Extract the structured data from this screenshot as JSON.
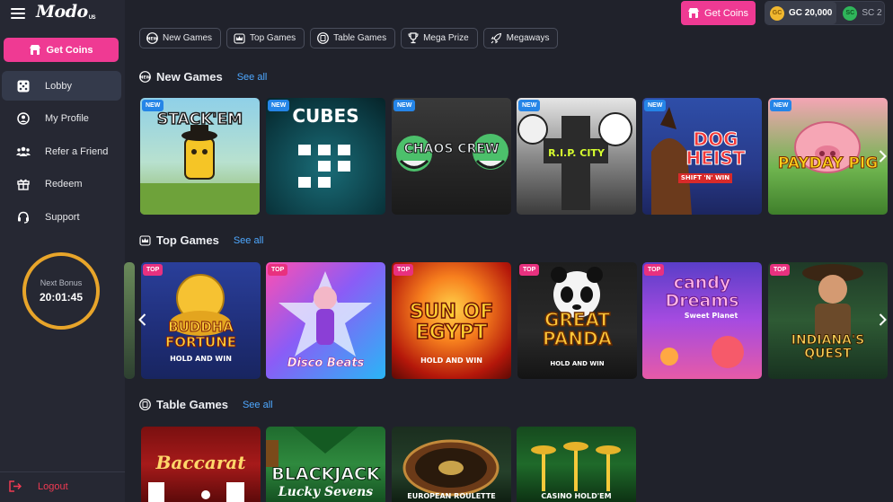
{
  "logo": {
    "name": "Modo",
    "suffix": "US"
  },
  "sidebar": {
    "get_coins": "Get Coins",
    "items": [
      {
        "label": "Lobby",
        "icon": "dice-icon"
      },
      {
        "label": "My Profile",
        "icon": "user-circle-icon"
      },
      {
        "label": "Refer a Friend",
        "icon": "users-icon"
      },
      {
        "label": "Redeem",
        "icon": "gift-icon"
      },
      {
        "label": "Support",
        "icon": "headset-icon"
      }
    ],
    "bonus": {
      "title": "Next Bonus",
      "time": "20:01:45"
    },
    "logout": "Logout"
  },
  "topbar": {
    "get_coins": "Get Coins",
    "gc": {
      "label": "GC 20,000",
      "icon": "GC"
    },
    "sc": {
      "label": "SC 2",
      "icon": "SC"
    }
  },
  "chips": [
    {
      "label": "New Games",
      "icon": "new-icon"
    },
    {
      "label": "Top Games",
      "icon": "crown-icon"
    },
    {
      "label": "Table Games",
      "icon": "cards-icon"
    },
    {
      "label": "Mega Prize",
      "icon": "trophy-icon"
    },
    {
      "label": "Megaways",
      "icon": "rocket-icon"
    }
  ],
  "sections": {
    "new_games": {
      "title": "New Games",
      "see_all": "See all",
      "badge": "NEW",
      "games": [
        {
          "title": "STACK'EM"
        },
        {
          "title": "CUBES"
        },
        {
          "title": "CHAOS CREW"
        },
        {
          "title": "R.I.P. CITY"
        },
        {
          "title": "DOG HEIST",
          "subtitle": "SHIFT 'N' WIN"
        },
        {
          "title": "PAYDAY PIG"
        }
      ]
    },
    "top_games": {
      "title": "Top Games",
      "see_all": "See all",
      "badge": "TOP",
      "games": [
        {
          "title": "BUDDHA FORTUNE",
          "subtitle": "HOLD AND WIN"
        },
        {
          "title": "Disco Beats"
        },
        {
          "title": "SUN OF EGYPT",
          "subtitle": "HOLD AND WIN"
        },
        {
          "title": "GREAT PANDA",
          "subtitle": "HOLD AND WIN"
        },
        {
          "title": "candy Dreams",
          "subtitle": "Sweet Planet"
        },
        {
          "title": "INDIANA'S QUEST"
        }
      ]
    },
    "table_games": {
      "title": "Table Games",
      "see_all": "See all",
      "games": [
        {
          "title": "Baccarat"
        },
        {
          "title": "BLACKJACK",
          "subtitle": "Lucky Sevens"
        },
        {
          "title": "EUROPEAN ROULETTE"
        },
        {
          "title": "CASINO HOLD'EM"
        }
      ]
    }
  }
}
